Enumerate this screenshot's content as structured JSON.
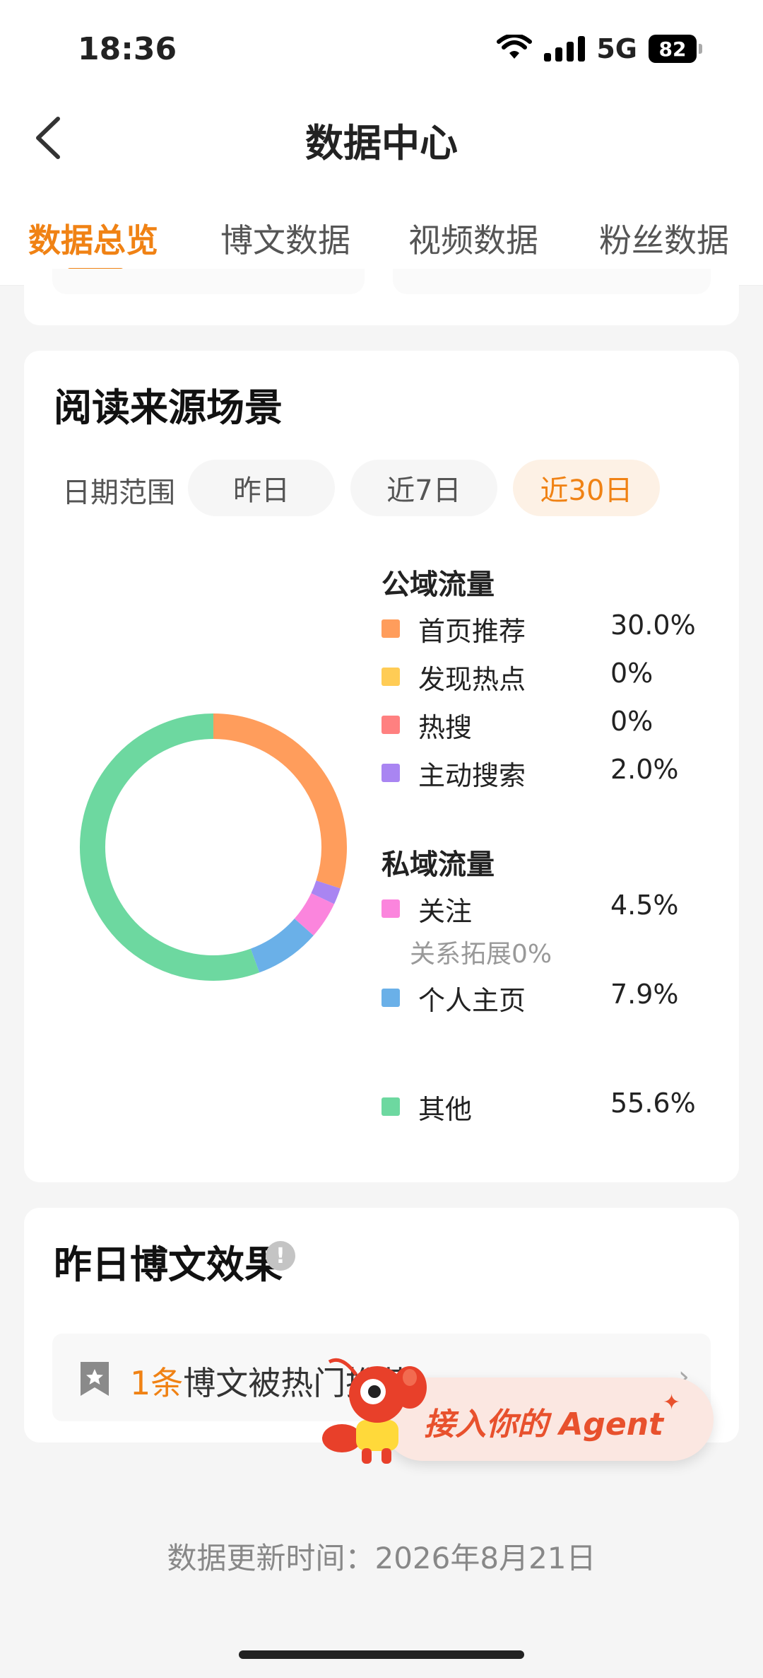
{
  "status_bar": {
    "time": "18:36",
    "network": "5G",
    "battery": "82"
  },
  "header": {
    "title": "数据中心",
    "back_icon": "chevron-left-icon"
  },
  "tabs": [
    {
      "label": "数据总览",
      "active": true
    },
    {
      "label": "博文数据",
      "active": false
    },
    {
      "label": "视频数据",
      "active": false
    },
    {
      "label": "粉丝数据",
      "active": false
    }
  ],
  "read_source": {
    "title": "阅读来源场景",
    "date_range_label": "日期范围",
    "date_options": [
      {
        "label": "昨日",
        "active": false
      },
      {
        "label": "近7日",
        "active": false
      },
      {
        "label": "近30日",
        "active": true
      }
    ],
    "public_header": "公域流量",
    "private_header": "私域流量",
    "sub_note": "关系拓展0%",
    "items": [
      {
        "label": "首页推荐",
        "value": "30.0%",
        "percent": 30.0,
        "color": "#ff9d5c"
      },
      {
        "label": "发现热点",
        "value": "0%",
        "percent": 0,
        "color": "#ffcc55"
      },
      {
        "label": "热搜",
        "value": "0%",
        "percent": 0,
        "color": "#ff8080"
      },
      {
        "label": "主动搜索",
        "value": "2.0%",
        "percent": 2.0,
        "color": "#a985f2"
      },
      {
        "label": "关注",
        "value": "4.5%",
        "percent": 4.5,
        "color": "#fb85dd"
      },
      {
        "label": "个人主页",
        "value": "7.9%",
        "percent": 7.9,
        "color": "#6ab0e8"
      },
      {
        "label": "其他",
        "value": "55.6%",
        "percent": 55.6,
        "color": "#6dd8a0"
      }
    ]
  },
  "effect": {
    "title": "昨日博文效果",
    "info_icon": "!",
    "recommend_count": "1条",
    "recommend_text": "博文被热门推荐",
    "chevron": "›"
  },
  "agent_banner": {
    "label": "接入你的 Agent",
    "sparkle": "✦"
  },
  "footer": {
    "update_time": "数据更新时间：2026年8月21日"
  },
  "colors": {
    "accent": "#f08214",
    "agent_text": "#e8512d"
  }
}
